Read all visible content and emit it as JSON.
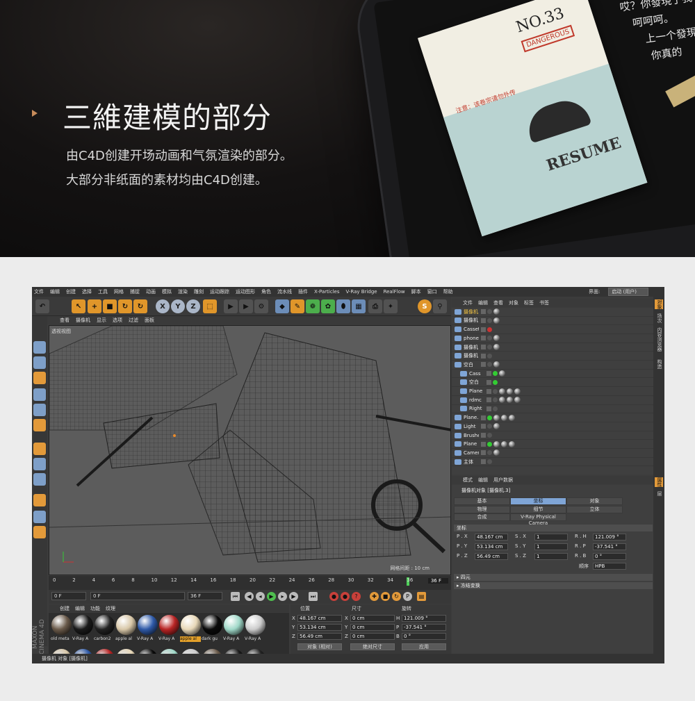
{
  "hero": {
    "title": "三維建模的部分",
    "desc_line1": "由C4D创建开场动画和气氛渲染的部分。",
    "desc_line2": "大部分非纸面的素材均由C4D创建。",
    "tablet": {
      "paper_no": "NO.33",
      "stamp": "DANGEROUS",
      "resume": "RESUME",
      "note": "注意：该卷宗请勿外传",
      "screen_lines": [
        "哎？你發現了我",
        "呵呵呵。",
        "上一个發現",
        "你真的"
      ]
    }
  },
  "c4d": {
    "menu": [
      "文件",
      "编辑",
      "创建",
      "选择",
      "工具",
      "网格",
      "捕捉",
      "动画",
      "模拟",
      "渲染",
      "雕刻",
      "运动跟踪",
      "运动图形",
      "角色",
      "流水线",
      "插件",
      "X-Particles",
      "V-Ray Bridge",
      "RealFlow",
      "脚本",
      "窗口",
      "帮助"
    ],
    "interface_label": "界面:",
    "interface_value": "启动 (用户)",
    "toolbar": {
      "x": "X",
      "y": "Y",
      "z": "Z",
      "s": "S"
    },
    "viewport_menu": [
      "查看",
      "摄像机",
      "显示",
      "选项",
      "过滤",
      "面板"
    ],
    "viewport_label": "透视视图",
    "grid_info": "网格间距 : 10 cm",
    "timeline_ticks": [
      "0",
      "2",
      "4",
      "6",
      "8",
      "10",
      "12",
      "14",
      "16",
      "18",
      "20",
      "22",
      "24",
      "26",
      "28",
      "30",
      "32",
      "34",
      "36"
    ],
    "timeline_end": "36 F",
    "transport": {
      "start": "0 F",
      "min": "0 F",
      "max": "36 F",
      "end": "36 F"
    },
    "mat_menu": [
      "创建",
      "编辑",
      "功能",
      "纹理"
    ],
    "materials": [
      {
        "label": "old meta",
        "color": "#6a5a4a"
      },
      {
        "label": "V-Ray A",
        "color": "#1a1a1a"
      },
      {
        "label": "carbon2",
        "color": "#222"
      },
      {
        "label": "apple al",
        "color": "#d8c7a8"
      },
      {
        "label": "V-Ray A",
        "color": "#2f5aa8"
      },
      {
        "label": "V-Ray A",
        "color": "#b82424"
      },
      {
        "label": "apple al",
        "color": "#e8d8b8"
      },
      {
        "label": "dark gu",
        "color": "#0a0a0a"
      },
      {
        "label": "V-Ray A",
        "color": "#9fd8c8"
      },
      {
        "label": "V-Ray A",
        "color": "#ccc"
      }
    ],
    "maxon": "MAXON CINEMA 4D",
    "coords": {
      "h_pos": "位置",
      "h_size": "尺寸",
      "h_rot": "旋转",
      "x_lbl": "X",
      "y_lbl": "Y",
      "z_lbl": "Z",
      "x": "48.167 cm",
      "y": "53.134 cm",
      "z": "56.49 cm",
      "sx": "0 cm",
      "sy": "0 cm",
      "sz": "0 cm",
      "h_lbl": "H",
      "p_lbl": "P",
      "b_lbl": "B",
      "h": "121.009 °",
      "p": "-37.541 °",
      "b": "0 °",
      "mode": "对象 (相对)",
      "size_mode": "绝对尺寸",
      "apply": "应用"
    },
    "status": "摄像机 对象 [摄像机]",
    "om_menu": [
      "文件",
      "编辑",
      "查看",
      "对象",
      "标签",
      "书签"
    ],
    "objects": [
      {
        "name": "摄像机.",
        "yellow": true,
        "dot": "#555"
      },
      {
        "name": "摄像机",
        "yellow": false,
        "dot": "#555"
      },
      {
        "name": "Cassette",
        "yellow": false,
        "dot": "#c33"
      },
      {
        "name": "phone",
        "yellow": false,
        "dot": "#555"
      },
      {
        "name": "摄像机",
        "yellow": false,
        "dot": "#555"
      },
      {
        "name": "摄像机",
        "yellow": false,
        "dot": "#555"
      },
      {
        "name": "空白",
        "yellow": false,
        "dot": "#555"
      },
      {
        "name": "Cass",
        "yellow": false,
        "dot": "#3c3"
      },
      {
        "name": "空白",
        "yellow": false,
        "dot": "#3c3"
      },
      {
        "name": "Plane",
        "yellow": false,
        "dot": "#555"
      },
      {
        "name": "rdmc",
        "yellow": false,
        "dot": "#555"
      },
      {
        "name": "Right",
        "yellow": false,
        "dot": "#555"
      },
      {
        "name": "Plane.1",
        "yellow": false,
        "dot": "#3c3"
      },
      {
        "name": "Light",
        "yellow": false,
        "dot": "#555"
      },
      {
        "name": "Brushes",
        "yellow": false,
        "dot": "#555"
      },
      {
        "name": "Plane",
        "yellow": false,
        "dot": "#3c3"
      },
      {
        "name": "Camera",
        "yellow": false,
        "dot": "#555"
      },
      {
        "name": "主体",
        "yellow": false,
        "dot": "#555"
      }
    ],
    "am_menu": [
      "模式",
      "编辑",
      "用户数据"
    ],
    "am_title": "摄像机对象 [摄像机.3]",
    "am_tabs": [
      "基本",
      "坐标",
      "对象",
      "物理",
      "细节",
      "立体",
      "合成",
      "V-Ray Physical Camera"
    ],
    "am_section": "坐标",
    "props": {
      "px": "P . X",
      "py": "P . Y",
      "pz": "P . Z",
      "sx": "S . X",
      "sy": "S . Y",
      "sz": "S . Z",
      "rh": "R . H",
      "rp": "R . P",
      "rb": "R . B",
      "px_v": "48.167 cm",
      "py_v": "53.134 cm",
      "pz_v": "56.49 cm",
      "sx_v": "1",
      "sy_v": "1",
      "sz_v": "1",
      "rh_v": "121.009 °",
      "rp_v": "-37.541 °",
      "rb_v": "0 °",
      "order_lbl": "顺序",
      "order_v": "HPB"
    },
    "sect_quat": "▸ 四元",
    "sect_freeze": "▸ 冻结变换",
    "right_tabs": [
      "对象",
      "场次",
      "内容浏览器",
      "构造",
      "属性",
      "层"
    ]
  }
}
